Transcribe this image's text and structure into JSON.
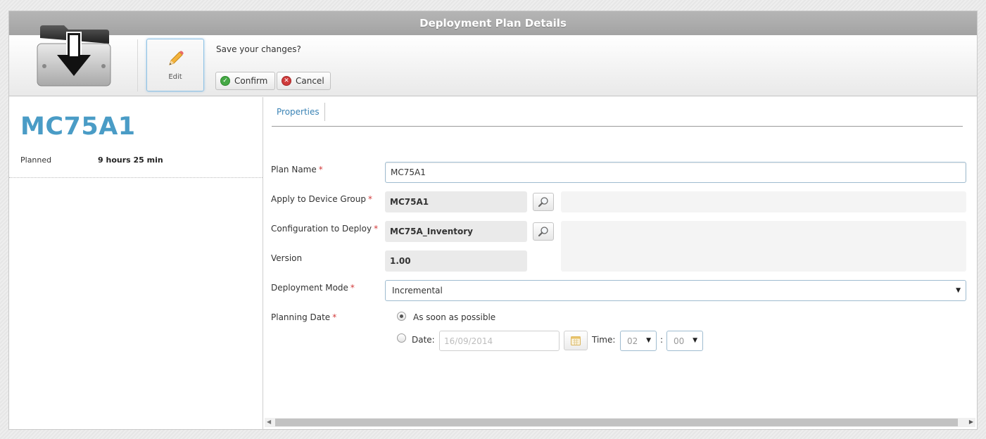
{
  "window": {
    "title": "Deployment Plan Details"
  },
  "toolbar": {
    "edit_label": "Edit",
    "prompt": "Save your changes?",
    "confirm_label": "Confirm",
    "cancel_label": "Cancel"
  },
  "summary": {
    "device_name": "MC75A1",
    "status_label": "Planned",
    "status_value": "9 hours 25 min"
  },
  "tabs": [
    {
      "label": "Properties",
      "active": true
    }
  ],
  "form": {
    "plan_name": {
      "label": "Plan Name",
      "value": "MC75A1",
      "required": "*"
    },
    "device_group": {
      "label": "Apply to Device Group",
      "value": "MC75A1",
      "required": "*"
    },
    "configuration": {
      "label": "Configuration to Deploy",
      "value": "MC75A_Inventory",
      "required": "*"
    },
    "version": {
      "label": "Version",
      "value": "1.00"
    },
    "deployment_mode": {
      "label": "Deployment Mode",
      "value": "Incremental",
      "required": "*"
    },
    "planning_date": {
      "label": "Planning Date",
      "required": "*",
      "option_asap": "As soon as possible",
      "option_date": "Date:",
      "date_value": "16/09/2014",
      "time_label": "Time:",
      "hour": "02",
      "separator": ":",
      "minute": "00",
      "selected": "asap"
    }
  },
  "colors": {
    "accent": "#4a9cc6",
    "required": "#d23b3b",
    "titlebar": "#a9a9a9",
    "confirm": "#45a845",
    "cancel": "#cf3b3b"
  },
  "icons": [
    "download-folder-icon",
    "pencil-icon",
    "check-icon",
    "close-icon",
    "search-icon",
    "calendar-icon",
    "chevron-down-icon"
  ]
}
